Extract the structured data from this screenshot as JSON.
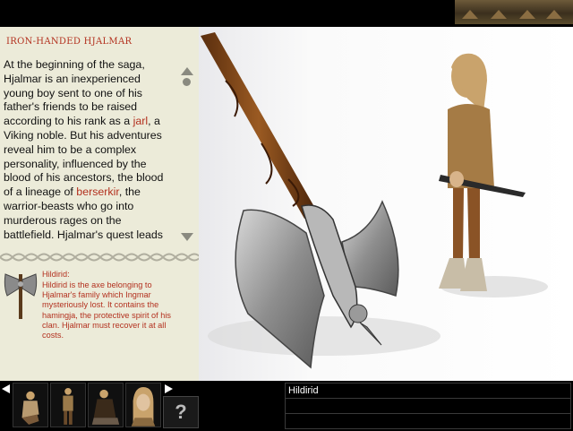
{
  "header": {
    "thumbnail_icon": "village-scene-icon"
  },
  "character": {
    "title": "IRON-HANDED HJALMAR",
    "story": {
      "p1": "At the beginning of the saga, Hjalmar is an inexperienced young boy sent to one of his father's friends to be raised according to his rank as a ",
      "link1": "jarl",
      "p2": ", a Viking noble. But his adventures reveal him to be a complex personality, influenced by the blood of his ancestors, the blood of a lineage of ",
      "link2": "berserkir",
      "p3": ", the warrior-beasts who go into murderous rages on the battlefield. Hjalmar's quest leads"
    }
  },
  "item": {
    "title": "Hildirid:",
    "description": "Hildirid is the axe belonging to Hjalmar's family which Ingmar mysteriously lost. It contains the hamingja, the protective spirit of his clan. Hjalmar must recover it at all costs.",
    "icon": "axe-icon"
  },
  "bottom": {
    "help_label": "?",
    "info_rows": [
      "Hildirid",
      "",
      ""
    ],
    "portraits": [
      "crouching-warrior-portrait",
      "standing-figure-portrait",
      "seated-elder-portrait",
      "hjalmar-portrait"
    ]
  },
  "colors": {
    "panel_bg": "#ecebd9",
    "accent_red": "#b3311f",
    "bar_bg": "#000000"
  }
}
